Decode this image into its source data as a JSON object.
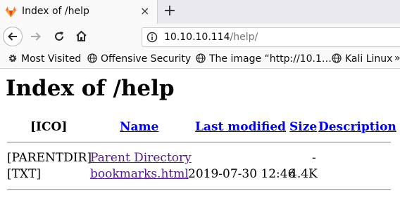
{
  "browser": {
    "tab_title": "Index of /help",
    "tab_close": "×",
    "new_tab": "+",
    "url_host": "10.10.10.114",
    "url_path": "/help/",
    "bookmarks": [
      {
        "label": "Most Visited",
        "icon": "gear-icon"
      },
      {
        "label": "Offensive Security",
        "icon": "globe-icon"
      },
      {
        "label": "The image “http://10.1…",
        "icon": "globe-icon"
      },
      {
        "label": "Kali Linux",
        "icon": "globe-icon"
      }
    ],
    "overflow": "»"
  },
  "page": {
    "heading": "Index of /help",
    "columns": {
      "icon": "[ICO]",
      "name": "Name",
      "modified": "Last modified",
      "size": "Size",
      "description": "Description"
    },
    "rows": [
      {
        "icon": "[PARENTDIR]",
        "name": "Parent Directory",
        "modified": "",
        "size": "-",
        "description": ""
      },
      {
        "icon": "[TXT]",
        "name": "bookmarks.html",
        "modified": "2019-07-30 12:46",
        "size": "4.4K",
        "description": ""
      }
    ]
  },
  "colors": {
    "link": "#0000ee",
    "visited_link": "#551a8b",
    "gitlab_orange": "#e24329"
  }
}
